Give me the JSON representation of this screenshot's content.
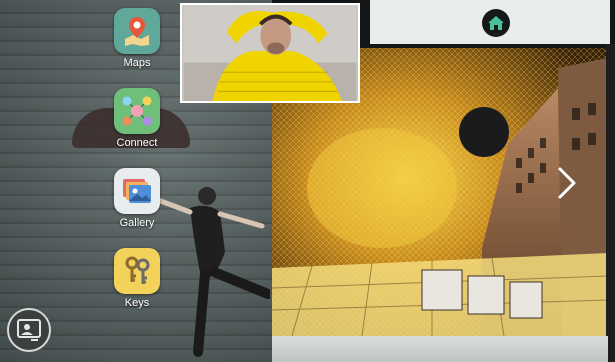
{
  "launcher": {
    "apps": [
      {
        "label": "Maps",
        "icon": "map-pin-icon"
      },
      {
        "label": "Connect",
        "icon": "people-network-icon"
      },
      {
        "label": "Gallery",
        "icon": "photos-icon"
      },
      {
        "label": "Keys",
        "icon": "keys-icon"
      }
    ]
  },
  "icons": {
    "home": "home-icon",
    "next": "chevron-right-icon",
    "profile": "profile-card-icon"
  },
  "colors": {
    "maps_tile": "#5fa89a",
    "connect_tile": "#6fbf7b",
    "gallery_tile": "#e9ecef",
    "keys_tile": "#f2d25b",
    "topbar": "#e9ecec",
    "home_button": "#151a19"
  }
}
